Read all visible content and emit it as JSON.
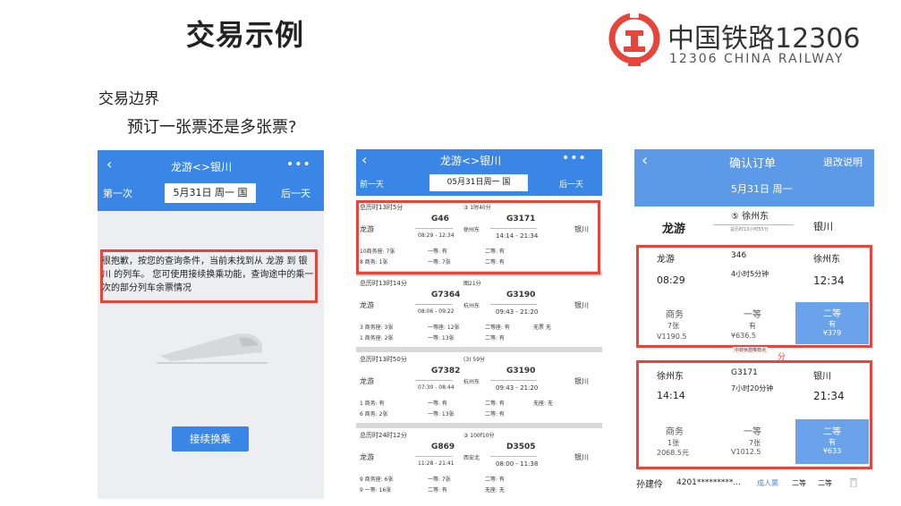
{
  "slide": {
    "title": "交易示例",
    "section": "交易边界",
    "question": "预订一张票还是多张票?"
  },
  "logo": {
    "cn": "中国铁路12306",
    "en": "12306 CHINA RAILWAY",
    "color": "#e5453a"
  },
  "screen1": {
    "title": "龙游<>银川",
    "menu": "•••",
    "prev": "第一次",
    "date": "5月31日 周一 国",
    "next": "后一天",
    "message": "很抱歉，按您的查询条件，当前未找到从 龙游 到 银川 的列车。 您可使用接续换乘功能，查询途中的乘一次的部分列车余票情况",
    "button": "接续换乘"
  },
  "screen2": {
    "title": "龙游<>银川",
    "menu": "•••",
    "prev": "前一天",
    "date": "05月31日周一 国",
    "next": "后一天",
    "cards": [
      {
        "total": "总历时13时5分",
        "mid_time": "③ 1时40分",
        "from": "龙游",
        "train1": "G46",
        "time1": "08:29 - 12:34",
        "transfer": "徐州东",
        "train2": "G3171",
        "time2": "14:14 - 21:34",
        "to": "银川",
        "r1a": "10商务座: 7张",
        "r1b": "一等: 有",
        "r1c": "二等: 有",
        "r1d": "",
        "r2a": "8 商务: 1张",
        "r2b": "一等: 7张",
        "r2c": "二等: 有"
      },
      {
        "total": "总历时13时14分",
        "mid_time": "图21分",
        "from": "龙游",
        "train1": "G7364",
        "time1": "08:06 - 09:22",
        "transfer": "杭州东",
        "train2": "G3190",
        "time2": "09:43 - 21:20",
        "to": "银川",
        "r1a": "3 商务座: 3张",
        "r1b": "一等座: 12张",
        "r1c": "二等座: 有",
        "r1d": "无票 无",
        "r2a": "1 商务座: 2张",
        "r2b": "一等: 13张",
        "r2c": "二等: 有"
      },
      {
        "total": "总历时13时50分",
        "mid_time": "(3) 59分",
        "from": "龙游",
        "train1": "G7382",
        "time1": "07:30 - 08:44",
        "transfer": "杭州东",
        "train2": "G3190",
        "time2": "09:43 - 21:20",
        "to": "银川",
        "r1a": "1 商务: 有",
        "r1b": "一等: 有",
        "r1c": "二等: 有",
        "r1d": "无座: 无",
        "r2a": "6 商务: 2张",
        "r2b": "一等: 13张",
        "r2c": "二等: 有"
      },
      {
        "total": "总历时24时12分",
        "mid_time": "③ 100f10分",
        "from": "龙游",
        "train1": "G869",
        "time1": "11:28 - 21:41",
        "transfer": "西安北",
        "train2": "D3505",
        "time2": "08:00 - 11:38",
        "to": "银川",
        "r1a": "9 商务座: 6张",
        "r1b": "一等: 7张",
        "r1c": "二等: 有",
        "r1d": "",
        "r2a": "9 一等: 16张",
        "r2b": "二等: 有",
        "r2c": "无座: 无"
      }
    ]
  },
  "screen3": {
    "back": "<",
    "title": "确认订单",
    "refund": "退改说明",
    "date": "5月31日 周一",
    "from": "龙游",
    "via": "⑤ 徐州东",
    "via_sub": "总历时13小时55分",
    "to": "银川",
    "leg1": {
      "from": "龙游",
      "train": "346",
      "to": "徐州东",
      "duration": "4小时5分钟",
      "dep": "08:29",
      "arr": "12:34",
      "c1": "商务",
      "c1n": "7张",
      "c1p": "V1190.5",
      "c2": "一等",
      "c2n": "有",
      "c2p": "¥636.5",
      "c3": "二等",
      "c3n": "有",
      "c3p": "¥379"
    },
    "middle": "中转休憩推荐点",
    "middle_tail": "分",
    "leg2": {
      "from": "徐州东",
      "train": "G3171",
      "to": "银川",
      "duration": "7小时20分钟",
      "dep": "14:14",
      "arr": "21:34",
      "c1": "商务",
      "c1n": "1张",
      "c1p": "2068.5元",
      "c2": "一等",
      "c2n": "7张",
      "c2p": "V1012.5",
      "c3": "二等",
      "c3n": "有",
      "c3p": "¥633"
    },
    "passenger": {
      "name": "孙建伶",
      "id": "4201*********...",
      "type": "成人票",
      "seat1": "二等",
      "seat2": "二等"
    }
  }
}
